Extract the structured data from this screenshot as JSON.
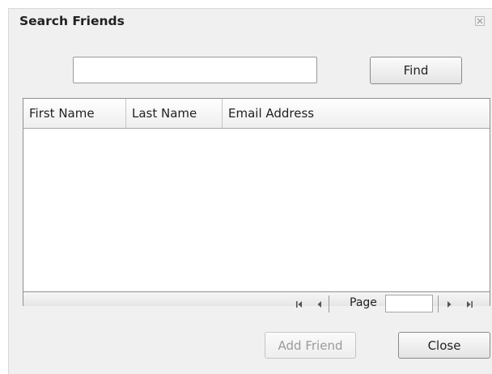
{
  "dialog": {
    "title": "Search Friends",
    "close_icon": "close-x-icon"
  },
  "search": {
    "value": "",
    "placeholder": "",
    "find_label": "Find"
  },
  "grid": {
    "columns": [
      "First Name",
      "Last Name",
      "Email Address"
    ],
    "rows": []
  },
  "pager": {
    "page_label": "Page",
    "page_value": "",
    "icons": [
      "first-page-icon",
      "prev-page-icon",
      "next-page-icon",
      "last-page-icon"
    ]
  },
  "footer": {
    "add_friend_label": "Add Friend",
    "close_label": "Close"
  }
}
